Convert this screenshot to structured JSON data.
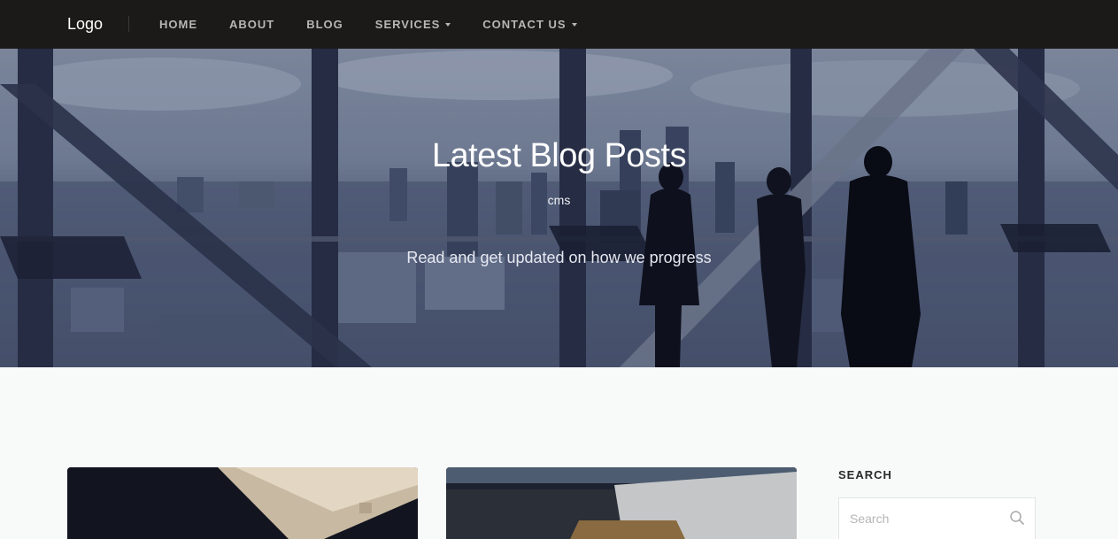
{
  "navbar": {
    "logo": "Logo",
    "items": [
      {
        "label": "HOME",
        "has_dropdown": false
      },
      {
        "label": "ABOUT",
        "has_dropdown": false
      },
      {
        "label": "BLOG",
        "has_dropdown": false
      },
      {
        "label": "SERVICES",
        "has_dropdown": true
      },
      {
        "label": "CONTACT US",
        "has_dropdown": true
      }
    ]
  },
  "hero": {
    "title": "Latest Blog Posts",
    "tag": "cms",
    "subtitle": "Read and get updated on how we progress"
  },
  "sidebar": {
    "search_title": "SEARCH",
    "search_placeholder": "Search"
  },
  "colors": {
    "navbar_bg": "#1b1a19",
    "nav_text": "#b7b6b4",
    "page_bg": "#f8f9f9"
  }
}
